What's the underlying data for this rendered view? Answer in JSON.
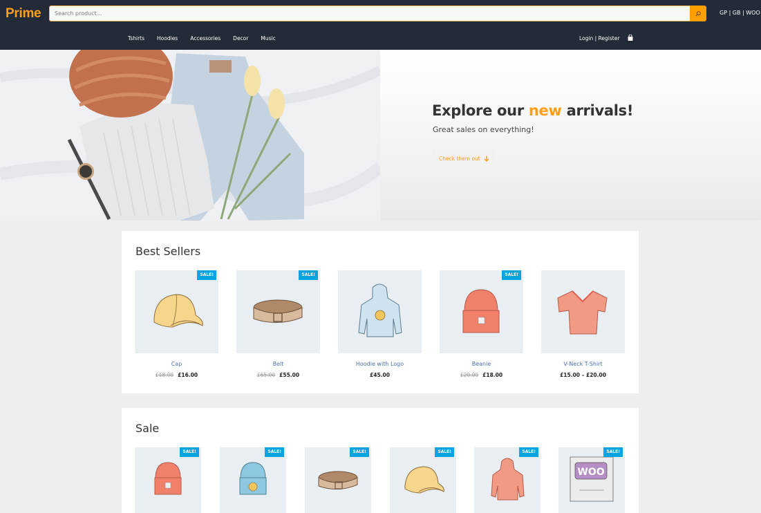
{
  "header": {
    "logo": "Prime",
    "search_placeholder": "Search product...",
    "search_value": "",
    "lang_links": "GP | GB | WOO",
    "nav": [
      "Tshirts",
      "Hoodies",
      "Accessories",
      "Decor",
      "Music"
    ],
    "account": "Login | Register",
    "icons": {
      "search": "search-icon",
      "cart": "shopping-bag-icon"
    }
  },
  "hero": {
    "title_before": "Explore our ",
    "title_accent": "new",
    "title_after": " arrivals!",
    "subtitle": "Great sales on everything!",
    "button_label": "Check them out",
    "button_icon": "arrow-down-icon"
  },
  "best_sellers": {
    "title": "Best Sellers",
    "products": [
      {
        "name": "Cap",
        "old_price": "£18.00",
        "price": "£16.00",
        "sale": true,
        "sale_label": "SALE!",
        "image": "cap"
      },
      {
        "name": "Belt",
        "old_price": "£65.00",
        "price": "£55.00",
        "sale": true,
        "sale_label": "SALE!",
        "image": "belt"
      },
      {
        "name": "Hoodie with Logo",
        "old_price": "",
        "price": "£45.00",
        "sale": false,
        "sale_label": "",
        "image": "hoodie-logo"
      },
      {
        "name": "Beanie",
        "old_price": "£20.00",
        "price": "£18.00",
        "sale": true,
        "sale_label": "SALE!",
        "image": "beanie-red"
      },
      {
        "name": "V-Neck T-Shirt",
        "old_price": "",
        "price": "£15.00 – £20.00",
        "sale": false,
        "sale_label": "",
        "image": "vneck"
      }
    ]
  },
  "sale": {
    "title": "Sale",
    "products": [
      {
        "sale_label": "SALE!",
        "image": "beanie-red"
      },
      {
        "sale_label": "SALE!",
        "image": "beanie-blue"
      },
      {
        "sale_label": "SALE!",
        "image": "belt"
      },
      {
        "sale_label": "SALE!",
        "image": "cap"
      },
      {
        "sale_label": "SALE!",
        "image": "hoodie-pink"
      },
      {
        "sale_label": "SALE!",
        "image": "woo-album"
      }
    ]
  },
  "colors": {
    "accent": "#ff9f1a",
    "header_bg": "#232b39",
    "badge": "#0ba3e0",
    "link": "#4a6ea9"
  }
}
